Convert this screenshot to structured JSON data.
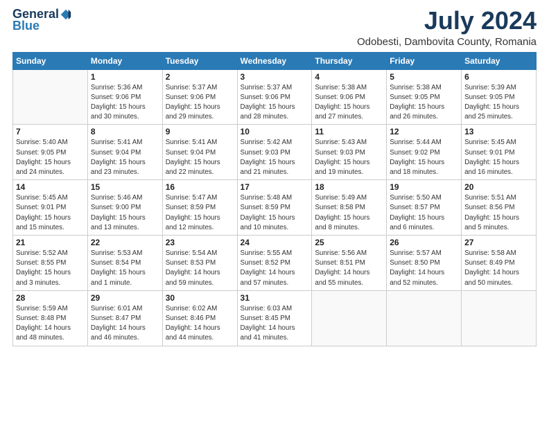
{
  "header": {
    "logo_general": "General",
    "logo_blue": "Blue",
    "month": "July 2024",
    "location": "Odobesti, Dambovita County, Romania"
  },
  "weekdays": [
    "Sunday",
    "Monday",
    "Tuesday",
    "Wednesday",
    "Thursday",
    "Friday",
    "Saturday"
  ],
  "weeks": [
    [
      {
        "day": "",
        "info": ""
      },
      {
        "day": "1",
        "info": "Sunrise: 5:36 AM\nSunset: 9:06 PM\nDaylight: 15 hours\nand 30 minutes."
      },
      {
        "day": "2",
        "info": "Sunrise: 5:37 AM\nSunset: 9:06 PM\nDaylight: 15 hours\nand 29 minutes."
      },
      {
        "day": "3",
        "info": "Sunrise: 5:37 AM\nSunset: 9:06 PM\nDaylight: 15 hours\nand 28 minutes."
      },
      {
        "day": "4",
        "info": "Sunrise: 5:38 AM\nSunset: 9:06 PM\nDaylight: 15 hours\nand 27 minutes."
      },
      {
        "day": "5",
        "info": "Sunrise: 5:38 AM\nSunset: 9:05 PM\nDaylight: 15 hours\nand 26 minutes."
      },
      {
        "day": "6",
        "info": "Sunrise: 5:39 AM\nSunset: 9:05 PM\nDaylight: 15 hours\nand 25 minutes."
      }
    ],
    [
      {
        "day": "7",
        "info": "Sunrise: 5:40 AM\nSunset: 9:05 PM\nDaylight: 15 hours\nand 24 minutes."
      },
      {
        "day": "8",
        "info": "Sunrise: 5:41 AM\nSunset: 9:04 PM\nDaylight: 15 hours\nand 23 minutes."
      },
      {
        "day": "9",
        "info": "Sunrise: 5:41 AM\nSunset: 9:04 PM\nDaylight: 15 hours\nand 22 minutes."
      },
      {
        "day": "10",
        "info": "Sunrise: 5:42 AM\nSunset: 9:03 PM\nDaylight: 15 hours\nand 21 minutes."
      },
      {
        "day": "11",
        "info": "Sunrise: 5:43 AM\nSunset: 9:03 PM\nDaylight: 15 hours\nand 19 minutes."
      },
      {
        "day": "12",
        "info": "Sunrise: 5:44 AM\nSunset: 9:02 PM\nDaylight: 15 hours\nand 18 minutes."
      },
      {
        "day": "13",
        "info": "Sunrise: 5:45 AM\nSunset: 9:01 PM\nDaylight: 15 hours\nand 16 minutes."
      }
    ],
    [
      {
        "day": "14",
        "info": "Sunrise: 5:45 AM\nSunset: 9:01 PM\nDaylight: 15 hours\nand 15 minutes."
      },
      {
        "day": "15",
        "info": "Sunrise: 5:46 AM\nSunset: 9:00 PM\nDaylight: 15 hours\nand 13 minutes."
      },
      {
        "day": "16",
        "info": "Sunrise: 5:47 AM\nSunset: 8:59 PM\nDaylight: 15 hours\nand 12 minutes."
      },
      {
        "day": "17",
        "info": "Sunrise: 5:48 AM\nSunset: 8:59 PM\nDaylight: 15 hours\nand 10 minutes."
      },
      {
        "day": "18",
        "info": "Sunrise: 5:49 AM\nSunset: 8:58 PM\nDaylight: 15 hours\nand 8 minutes."
      },
      {
        "day": "19",
        "info": "Sunrise: 5:50 AM\nSunset: 8:57 PM\nDaylight: 15 hours\nand 6 minutes."
      },
      {
        "day": "20",
        "info": "Sunrise: 5:51 AM\nSunset: 8:56 PM\nDaylight: 15 hours\nand 5 minutes."
      }
    ],
    [
      {
        "day": "21",
        "info": "Sunrise: 5:52 AM\nSunset: 8:55 PM\nDaylight: 15 hours\nand 3 minutes."
      },
      {
        "day": "22",
        "info": "Sunrise: 5:53 AM\nSunset: 8:54 PM\nDaylight: 15 hours\nand 1 minute."
      },
      {
        "day": "23",
        "info": "Sunrise: 5:54 AM\nSunset: 8:53 PM\nDaylight: 14 hours\nand 59 minutes."
      },
      {
        "day": "24",
        "info": "Sunrise: 5:55 AM\nSunset: 8:52 PM\nDaylight: 14 hours\nand 57 minutes."
      },
      {
        "day": "25",
        "info": "Sunrise: 5:56 AM\nSunset: 8:51 PM\nDaylight: 14 hours\nand 55 minutes."
      },
      {
        "day": "26",
        "info": "Sunrise: 5:57 AM\nSunset: 8:50 PM\nDaylight: 14 hours\nand 52 minutes."
      },
      {
        "day": "27",
        "info": "Sunrise: 5:58 AM\nSunset: 8:49 PM\nDaylight: 14 hours\nand 50 minutes."
      }
    ],
    [
      {
        "day": "28",
        "info": "Sunrise: 5:59 AM\nSunset: 8:48 PM\nDaylight: 14 hours\nand 48 minutes."
      },
      {
        "day": "29",
        "info": "Sunrise: 6:01 AM\nSunset: 8:47 PM\nDaylight: 14 hours\nand 46 minutes."
      },
      {
        "day": "30",
        "info": "Sunrise: 6:02 AM\nSunset: 8:46 PM\nDaylight: 14 hours\nand 44 minutes."
      },
      {
        "day": "31",
        "info": "Sunrise: 6:03 AM\nSunset: 8:45 PM\nDaylight: 14 hours\nand 41 minutes."
      },
      {
        "day": "",
        "info": ""
      },
      {
        "day": "",
        "info": ""
      },
      {
        "day": "",
        "info": ""
      }
    ]
  ]
}
